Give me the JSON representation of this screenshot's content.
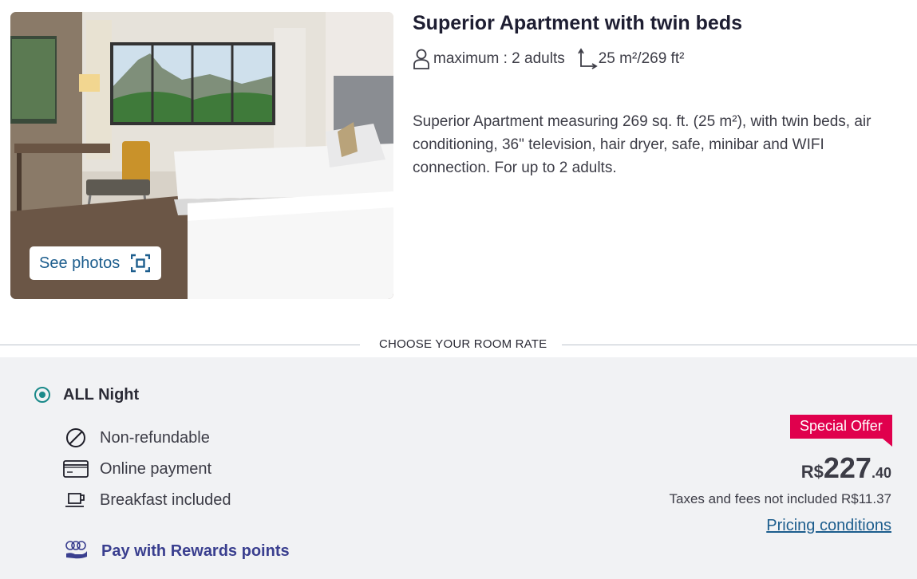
{
  "room": {
    "title": "Superior Apartment with twin beds",
    "occupancy": "maximum : 2 adults",
    "size": "25 m²/269 ft²",
    "description": "Superior Apartment measuring 269 sq. ft. (25 m²), with twin beds, air conditioning, 36\" television, hair dryer, safe, minibar and WIFI connection. For up to 2 adults.",
    "see_photos_label": "See photos"
  },
  "section_label": "CHOOSE YOUR ROOM RATE",
  "rate": {
    "name": "ALL Night",
    "selected": true,
    "features": [
      {
        "icon": "no-refund-icon",
        "label": "Non-refundable"
      },
      {
        "icon": "credit-card-icon",
        "label": "Online payment"
      },
      {
        "icon": "coffee-cup-icon",
        "label": "Breakfast included"
      }
    ],
    "rewards_label": "Pay with Rewards points",
    "offer_badge": "Special Offer",
    "price": {
      "currency": "R$",
      "integer": "227",
      "decimal": ".40"
    },
    "taxes": "Taxes and fees not included R$11.37",
    "pricing_conditions": "Pricing conditions"
  },
  "colors": {
    "accent_teal": "#1b8a8a",
    "link_blue": "#1c5d8d",
    "offer_red": "#e0004d",
    "rewards_purple": "#3a3f8f"
  }
}
